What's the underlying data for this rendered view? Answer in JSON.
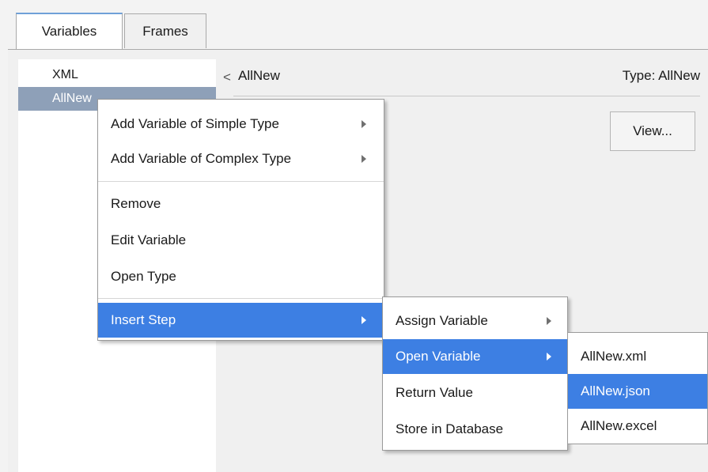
{
  "tabs": [
    {
      "label": "Variables",
      "active": true
    },
    {
      "label": "Frames",
      "active": false
    }
  ],
  "variables": [
    "XML",
    "AllNew"
  ],
  "selected_variable": "AllNew",
  "detail": {
    "title": "AllNew",
    "type_label": "Type: AllNew",
    "view_button": "View...",
    "chevron": "<"
  },
  "context_menu": {
    "items": [
      {
        "label": "Add Variable of Simple Type",
        "submenu": true
      },
      {
        "label": "Add Variable of Complex Type",
        "submenu": true
      },
      {
        "label": "Remove",
        "submenu": false
      },
      {
        "label": "Edit Variable",
        "submenu": false
      },
      {
        "label": "Open Type",
        "submenu": false
      },
      {
        "label": "Insert Step",
        "submenu": true,
        "highlighted": true
      }
    ]
  },
  "insert_step_menu": {
    "items": [
      {
        "label": "Assign Variable",
        "submenu": true
      },
      {
        "label": "Open Variable",
        "submenu": true,
        "highlighted": true
      },
      {
        "label": "Return Value",
        "submenu": false
      },
      {
        "label": "Store in Database",
        "submenu": false
      }
    ]
  },
  "open_variable_menu": {
    "items": [
      {
        "label": "AllNew.xml"
      },
      {
        "label": "AllNew.json",
        "highlighted": true
      },
      {
        "label": "AllNew.excel"
      }
    ]
  },
  "colors": {
    "highlight": "#3d7fe3",
    "selection": "#8ea0b8",
    "tab_accent": "#6fa0d8"
  }
}
